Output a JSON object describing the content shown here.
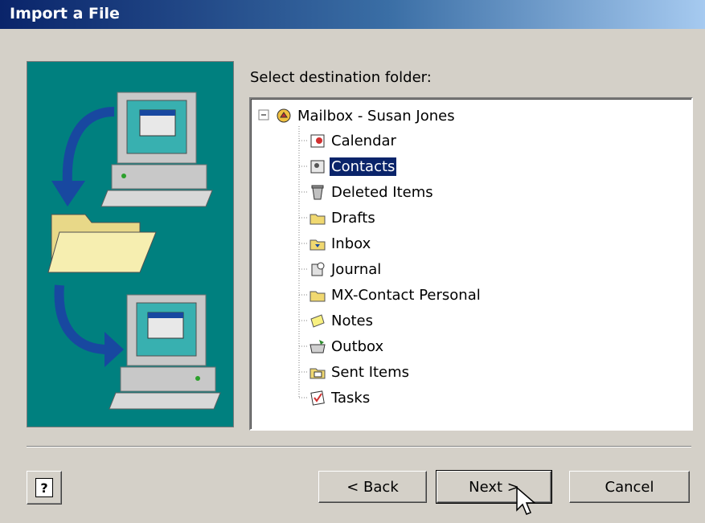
{
  "window": {
    "title": "Import a File"
  },
  "illustration": {
    "icon": "import-illustration",
    "background": "#00807f"
  },
  "destination": {
    "label": "Select destination folder:",
    "root": {
      "label": "Mailbox - Susan Jones",
      "icon": "mailbox-icon",
      "expander": "⊟"
    },
    "folders": [
      {
        "label": "Calendar",
        "icon": "calendar-icon"
      },
      {
        "label": "Contacts",
        "icon": "contacts-icon",
        "selected": true
      },
      {
        "label": "Deleted Items",
        "icon": "trash-icon"
      },
      {
        "label": "Drafts",
        "icon": "drafts-icon"
      },
      {
        "label": "Inbox",
        "icon": "inbox-icon"
      },
      {
        "label": "Journal",
        "icon": "journal-icon"
      },
      {
        "label": "MX-Contact Personal",
        "icon": "folder-icon"
      },
      {
        "label": "Notes",
        "icon": "notes-icon"
      },
      {
        "label": "Outbox",
        "icon": "outbox-icon"
      },
      {
        "label": "Sent Items",
        "icon": "sent-items-icon"
      },
      {
        "label": "Tasks",
        "icon": "tasks-icon"
      }
    ]
  },
  "buttons": {
    "help": "?",
    "back": "< Back",
    "next": "Next >",
    "cancel": "Cancel"
  },
  "colors": {
    "accent": "#0a246a",
    "dialog": "#d4d0c8",
    "selection": "#0a246a"
  }
}
